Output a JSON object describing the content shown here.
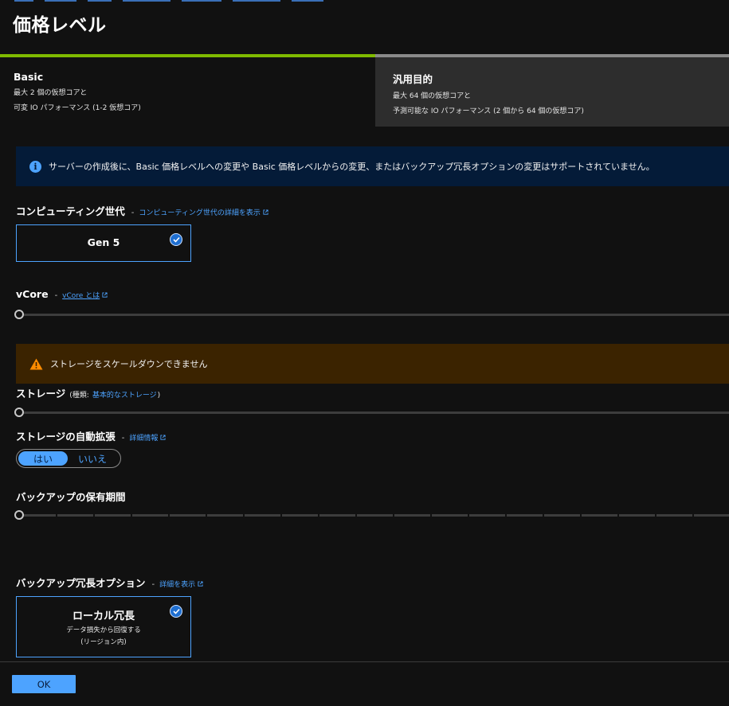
{
  "page": {
    "title": "価格レベル"
  },
  "tiers": [
    {
      "name": "Basic",
      "line1": "最大 2 個の仮想コアと",
      "line2": "可変 IO パフォーマンス (1-2 仮想コア)",
      "selected": true
    },
    {
      "name": "汎用目的",
      "line1": "最大 64 個の仮想コアと",
      "line2": "予測可能な IO パフォーマンス (2 個から 64 個の仮想コア)",
      "selected": false
    }
  ],
  "info": {
    "text": "サーバーの作成後に、Basic 価格レベルへの変更や Basic 価格レベルからの変更、またはバックアップ冗長オプションの変更はサポートされていません。",
    "icon": "info-icon"
  },
  "compute": {
    "label": "コンピューティング世代",
    "separator": "-",
    "link": "コンピューティング世代の詳細を表示",
    "option": "Gen 5",
    "selected": true
  },
  "vcore": {
    "label": "vCore",
    "separator": "-",
    "link": "vCore とは",
    "value_fraction": 0
  },
  "warning": {
    "text": "ストレージをスケールダウンできません",
    "icon": "warning-icon",
    "color": "#3b2300"
  },
  "storage": {
    "label": "ストレージ",
    "type_prefix": "(種類:",
    "type_value": "基本的なストレージ",
    "type_suffix": ")",
    "value_fraction": 0
  },
  "autogrow": {
    "label": "ストレージの自動拡張",
    "separator": "-",
    "link": "詳細情報",
    "options": [
      "はい",
      "いいえ"
    ],
    "selected": "はい"
  },
  "backup_retention": {
    "label": "バックアップの保有期間",
    "value_fraction": 0
  },
  "redundancy": {
    "label": "バックアップ冗長オプション",
    "separator": "-",
    "link": "詳細を表示",
    "option_title": "ローカル冗長",
    "option_desc1": "データ損失から回復する",
    "option_desc2": "(リージョン内)",
    "selected": true
  },
  "footer": {
    "ok_label": "OK"
  },
  "colors": {
    "accent": "#4da3ff",
    "basic_tab": "#7fba00",
    "info_bg": "#041b38"
  }
}
